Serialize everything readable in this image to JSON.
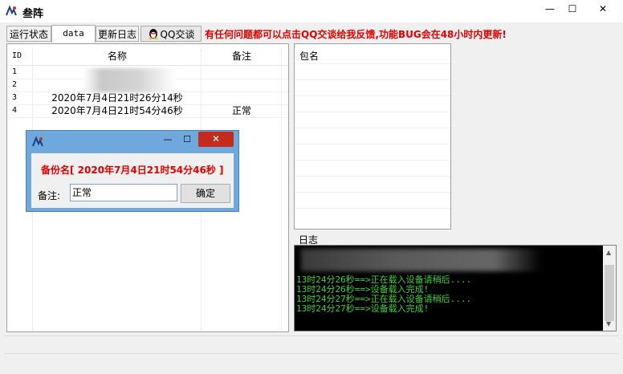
{
  "window": {
    "title": "叁阵",
    "min_glyph": "—",
    "max_glyph": "☐",
    "close_glyph": "✕"
  },
  "tabs": [
    {
      "label": "运行状态"
    },
    {
      "label": "data"
    },
    {
      "label": "更新日志"
    },
    {
      "label": "QQ交谈"
    }
  ],
  "notice": "有任何问题都可以点击QQ交谈给我反馈,功能BUG会在48小时内更新!",
  "table": {
    "columns": [
      "ID",
      "名称",
      "备注"
    ],
    "rows": [
      {
        "id": "1",
        "name": "",
        "note": ""
      },
      {
        "id": "2",
        "name": "",
        "note": ""
      },
      {
        "id": "3",
        "name": "2020年7月4日21时26分14秒",
        "note": ""
      },
      {
        "id": "4",
        "name": "2020年7月4日21时54分46秒",
        "note": "正常"
      }
    ]
  },
  "packages": {
    "header": "包名"
  },
  "log": {
    "label": "日志",
    "lines": [
      "13时24分26秒==>正在载入设备请稍后....",
      "13时24分26秒==>设备载入完成!",
      "13时24分27秒==>正在载入设备请稍后....",
      "13时24分27秒==>设备载入完成!"
    ]
  },
  "dialog": {
    "min_glyph": "—",
    "max_glyph": "☐",
    "close_glyph": "✕",
    "backup_name": "备份名[ 2020年7月4日21时54分46秒 ]",
    "note_label": "备注:",
    "note_value": "正常",
    "ok_label": "确定"
  },
  "colors": {
    "accent_red": "#e00000",
    "log_green": "#3cd23c",
    "dialog_border": "#6fa8dc"
  }
}
